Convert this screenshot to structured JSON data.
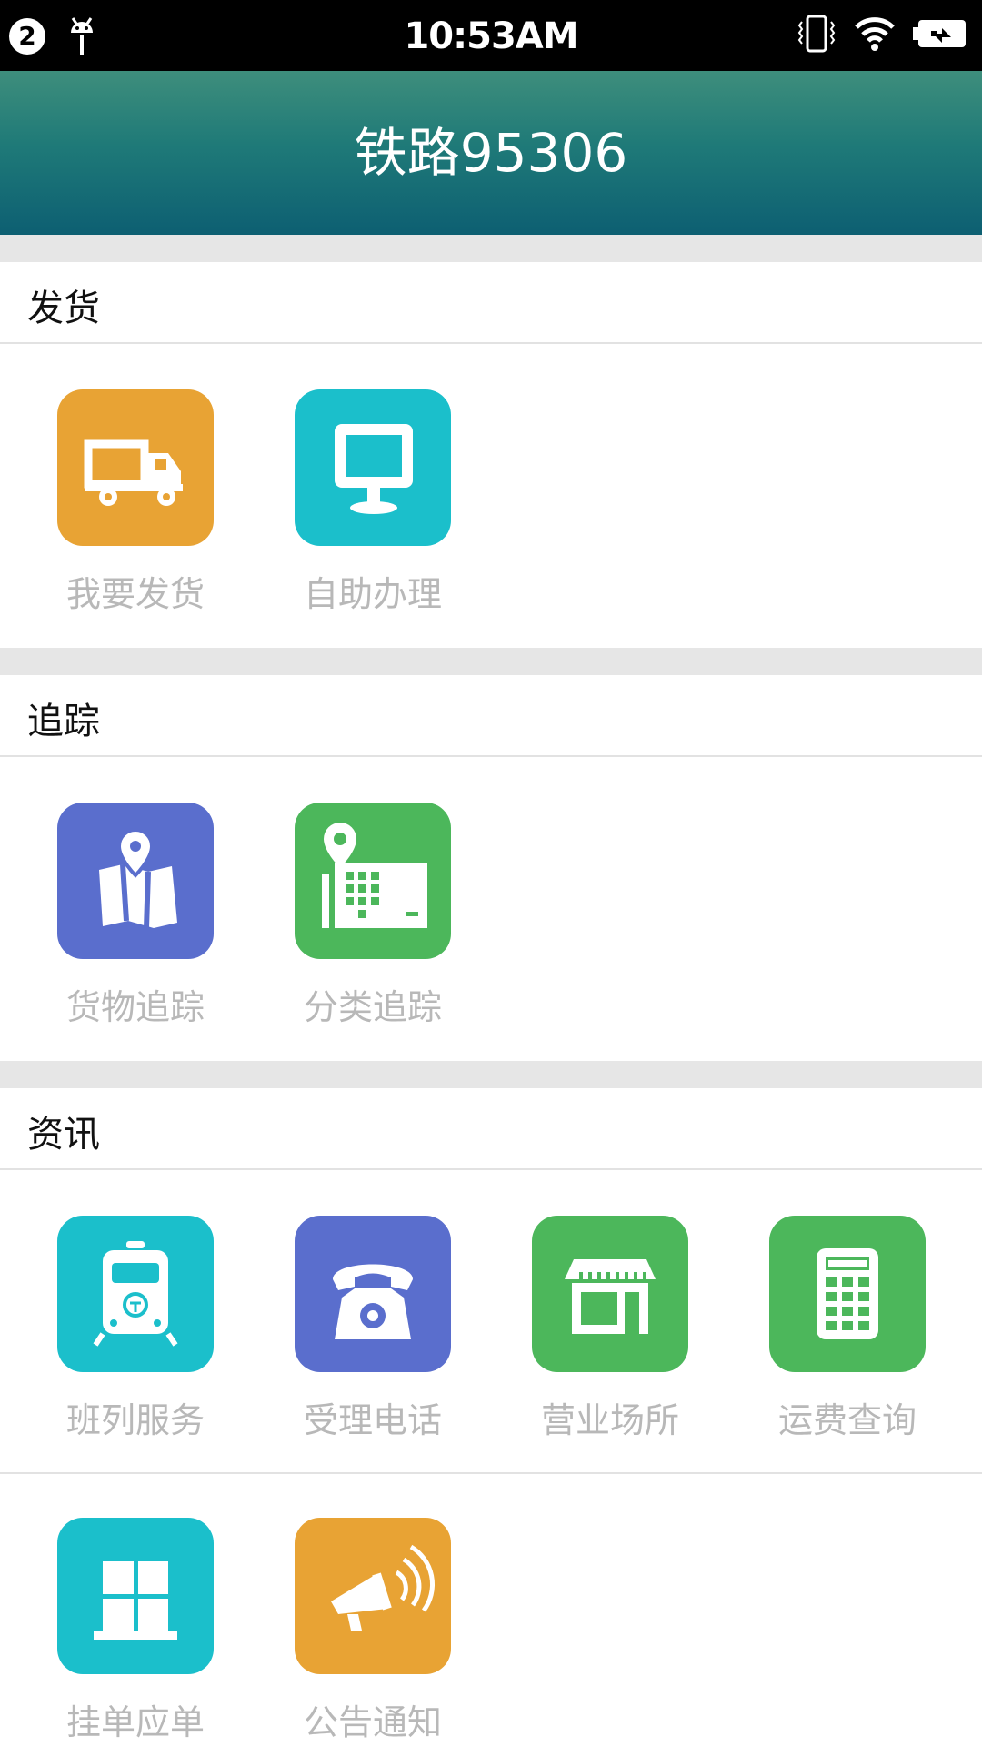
{
  "status_bar": {
    "notification_count": "2",
    "time": "10:53AM",
    "icons": [
      "android-icon",
      "vibrate-icon",
      "wifi-icon",
      "battery-charging-icon"
    ]
  },
  "header": {
    "title": "铁路95306"
  },
  "sections": [
    {
      "title": "发货",
      "items": [
        {
          "label": "我要发货",
          "icon": "truck-icon",
          "color": "#e8a334"
        },
        {
          "label": "自助办理",
          "icon": "monitor-icon",
          "color": "#1bbfcb"
        }
      ]
    },
    {
      "title": "追踪",
      "items": [
        {
          "label": "货物追踪",
          "icon": "map-pin-icon",
          "color": "#5a6ecd"
        },
        {
          "label": "分类追踪",
          "icon": "location-building-icon",
          "color": "#4cb75b"
        }
      ]
    },
    {
      "title": "资讯",
      "items": [
        {
          "label": "班列服务",
          "icon": "train-icon",
          "color": "#1bbfcb"
        },
        {
          "label": "受理电话",
          "icon": "telephone-icon",
          "color": "#5a6ecd"
        },
        {
          "label": "营业场所",
          "icon": "store-icon",
          "color": "#4cb75b"
        },
        {
          "label": "运费查询",
          "icon": "calculator-icon",
          "color": "#4cb75b"
        },
        {
          "label": "挂单应单",
          "icon": "window-grid-icon",
          "color": "#1bbfcb"
        },
        {
          "label": "公告通知",
          "icon": "megaphone-icon",
          "color": "#e8a334"
        }
      ]
    }
  ]
}
